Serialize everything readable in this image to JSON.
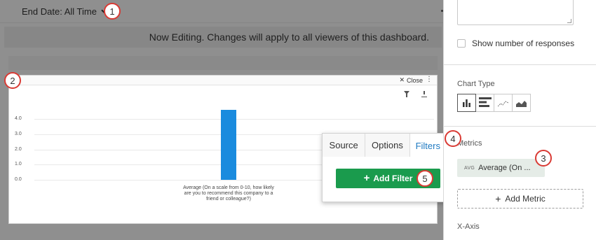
{
  "toolbar": {
    "end_date_label": "End Date: All Time"
  },
  "editing_banner": "Now Editing. Changes will apply to all viewers of this dashboard.",
  "widget": {
    "close_label": "Close",
    "kebab": "⋮"
  },
  "chart_data": {
    "type": "bar",
    "categories": [
      "Average (On a scale from 0-10, how likely are you to recommend this company to a friend or colleague?)"
    ],
    "values": [
      4.6
    ],
    "yticks": [
      "4.0",
      "3.0",
      "2.0",
      "1.0",
      "0.0"
    ],
    "ylim": [
      0,
      5
    ],
    "bar_color": "#1a8bde",
    "grid": true
  },
  "popover": {
    "tabs": [
      {
        "label": "Source"
      },
      {
        "label": "Options"
      },
      {
        "label": "Filters",
        "active": true
      }
    ],
    "add_filter_label": "Add Filter",
    "button_color": "#1a9b4d"
  },
  "panel": {
    "show_responses_label": "Show number of responses",
    "chart_type_label": "Chart Type",
    "chart_types": [
      "bar-chart-icon",
      "horizontal-bar-icon",
      "line-chart-icon",
      "area-chart-icon"
    ],
    "metrics_label": "Metrics",
    "metric_avg_tag": "AVG",
    "metric_name": "Average (On ...",
    "add_metric_label": "Add Metric",
    "xaxis_label": "X-Axis"
  },
  "callouts": [
    "1",
    "2",
    "3",
    "4",
    "5"
  ]
}
